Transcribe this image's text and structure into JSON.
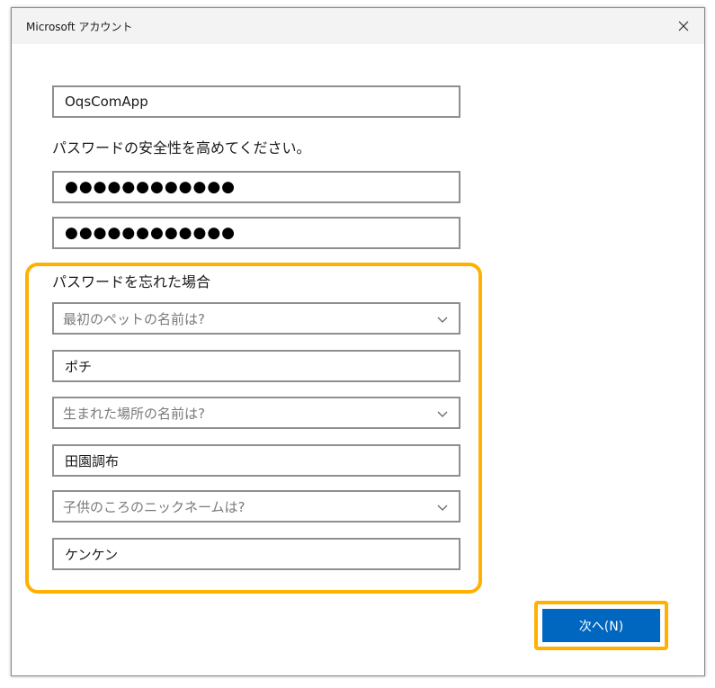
{
  "window": {
    "title": "Microsoft アカウント",
    "close_symbol": "✕"
  },
  "form": {
    "username_value": "OqsComApp",
    "password_hint": "パスワードの安全性を高めてください。",
    "password_value": "●●●●●●●●●●●●",
    "confirm_password_value": "●●●●●●●●●●●●",
    "recovery_heading": "パスワードを忘れた場合",
    "questions": [
      {
        "question": "最初のペットの名前は?",
        "answer": "ポチ"
      },
      {
        "question": "生まれた場所の名前は?",
        "answer": "田園調布"
      },
      {
        "question": "子供のころのニックネームは?",
        "answer": "ケンケン"
      }
    ]
  },
  "actions": {
    "next_label": "次へ(N)"
  },
  "colors": {
    "highlight": "#ffb000",
    "primary_button": "#0067c0"
  }
}
